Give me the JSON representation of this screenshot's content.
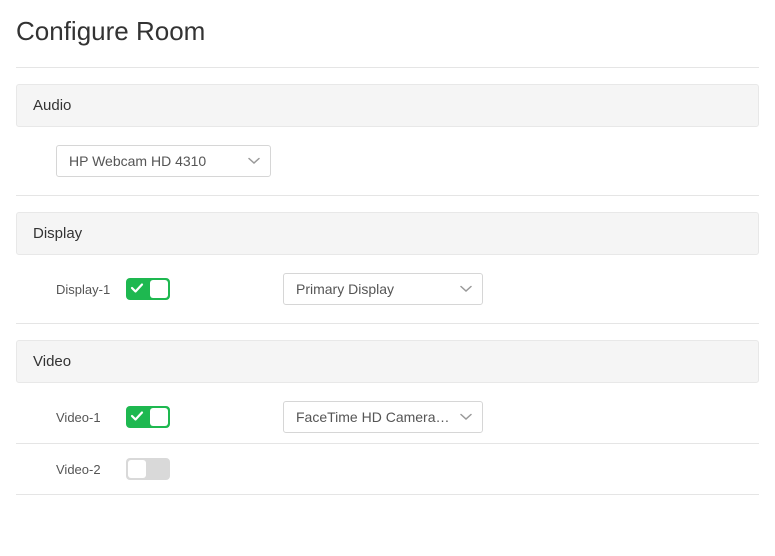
{
  "title": "Configure Room",
  "sections": {
    "audio": {
      "header": "Audio",
      "device": "HP Webcam HD 4310"
    },
    "display": {
      "header": "Display",
      "items": [
        {
          "label": "Display-1",
          "enabled": true,
          "selected": "Primary Display"
        }
      ]
    },
    "video": {
      "header": "Video",
      "items": [
        {
          "label": "Video-1",
          "enabled": true,
          "selected": "FaceTime HD Camera (..."
        },
        {
          "label": "Video-2",
          "enabled": false,
          "selected": ""
        }
      ]
    }
  },
  "colors": {
    "toggle_on": "#1eb850",
    "toggle_off": "#d9d9d9"
  }
}
